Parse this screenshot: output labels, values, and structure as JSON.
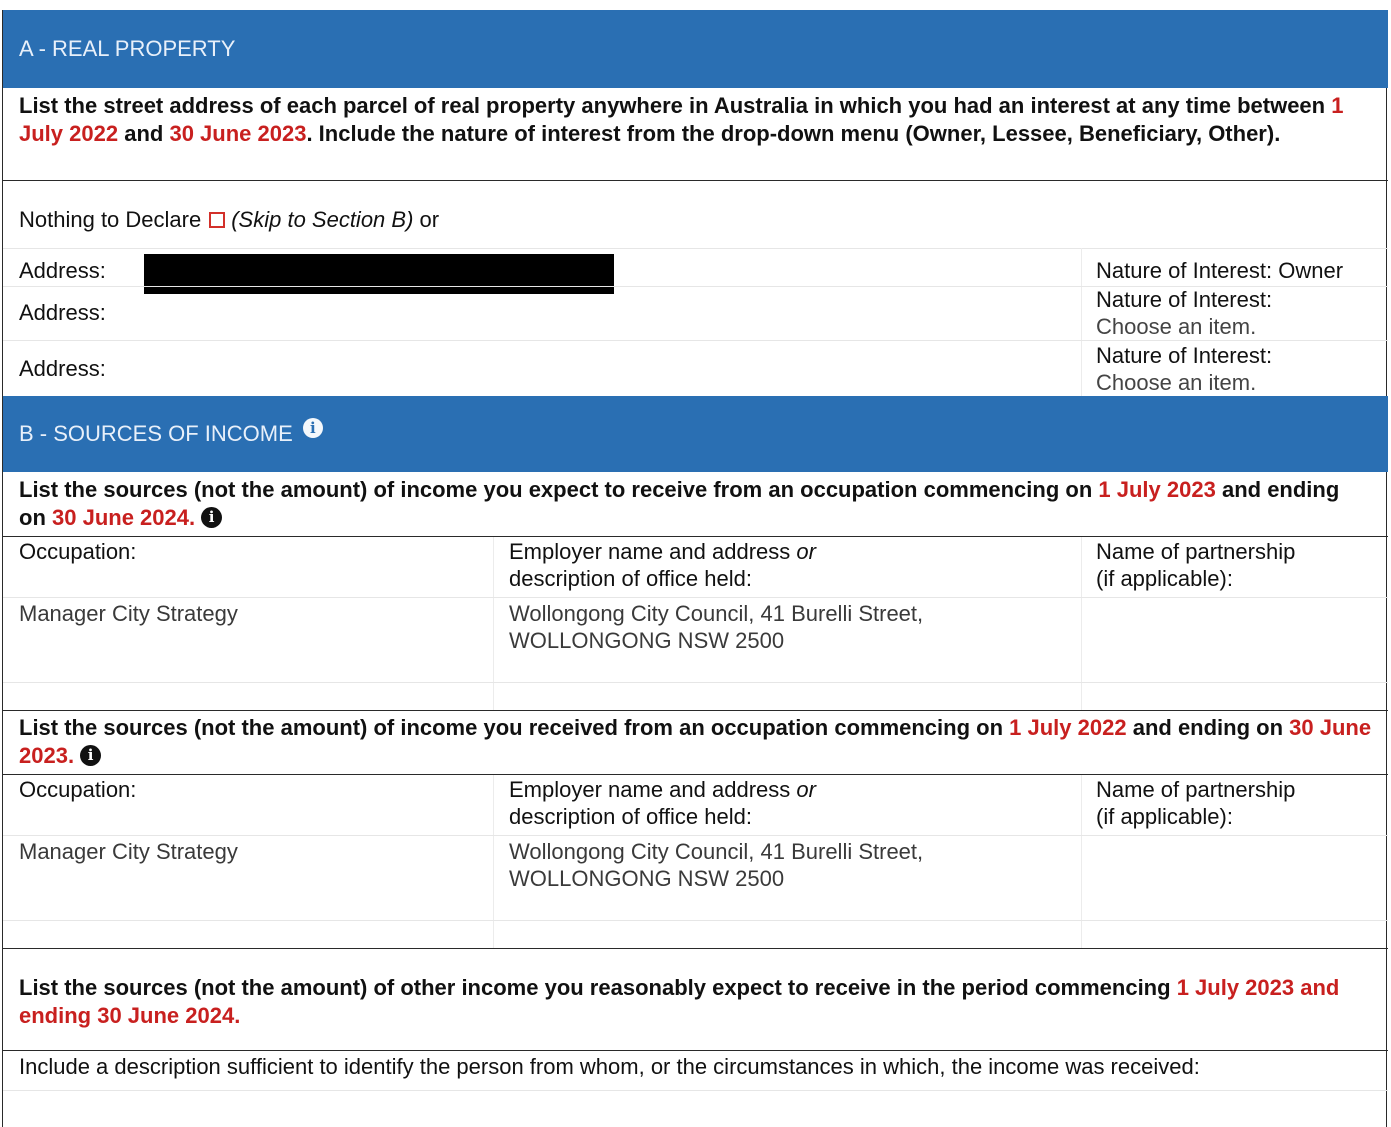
{
  "section_a": {
    "title": "A - REAL PROPERTY",
    "instruction": {
      "part1": "List the street address of each parcel of real property anywhere in Australia in which you had an interest at any time between",
      "date1": "1 July 2022",
      "and": "and",
      "date2": "30 June 2023",
      "part2": ". Include the nature of interest from the drop-down menu (Owner, Lessee, Beneficiary, Other)."
    },
    "nothing_to_declare": {
      "label": "Nothing to Declare",
      "skip": "(Skip to Section B)",
      "suffix": "or"
    },
    "properties": [
      {
        "address_label": "Address:",
        "nature_label": "Nature of Interest:",
        "nature_value": "Owner"
      },
      {
        "address_label": "Address:",
        "nature_label": "Nature of Interest:",
        "nature_value": "Choose an item."
      },
      {
        "address_label": "Address:",
        "nature_label": "Nature of Interest:",
        "nature_value": "Choose an item."
      }
    ]
  },
  "section_b": {
    "title": "B - SOURCES OF INCOME",
    "info_glyph": "i",
    "current": {
      "part1": "List the sources (not the amount) of income you expect to receive from an occupation commencing on",
      "date1": "1 July 2023",
      "and": "and ending on",
      "date2": "30 June 2024."
    },
    "previous": {
      "part1": "List the sources (not the amount) of income you received from an occupation commencing on",
      "date1": "1 July 2022",
      "and": "and ending on",
      "date2": "30 June 2023."
    },
    "columns": {
      "occupation": "Occupation:",
      "employer_line1a": "Employer name and address",
      "employer_or": "or",
      "employer_line2": "description of office held:",
      "partnership_line1": "Name of partnership",
      "partnership_line2": "(if applicable):"
    },
    "current_entry": {
      "occupation": "Manager City Strategy",
      "employer_line1": "Wollongong City Council, 41 Burelli Street,",
      "employer_line2": "WOLLONGONG NSW 2500",
      "partnership": ""
    },
    "previous_entry": {
      "occupation": "Manager City Strategy",
      "employer_line1": "Wollongong City Council, 41 Burelli Street,",
      "employer_line2": "WOLLONGONG NSW 2500",
      "partnership": ""
    },
    "other_income": {
      "part1": "List the sources (not the amount) of other income you reasonably expect to receive in the period commencing",
      "date_part": "1 July 2023 and ending 30 June 2024."
    },
    "description_note": "Include a description sufficient to identify the person from whom, or the circumstances in which, the income was received:"
  },
  "colors": {
    "header_blue": "#2a6fb3",
    "date_red": "#c8201f"
  }
}
